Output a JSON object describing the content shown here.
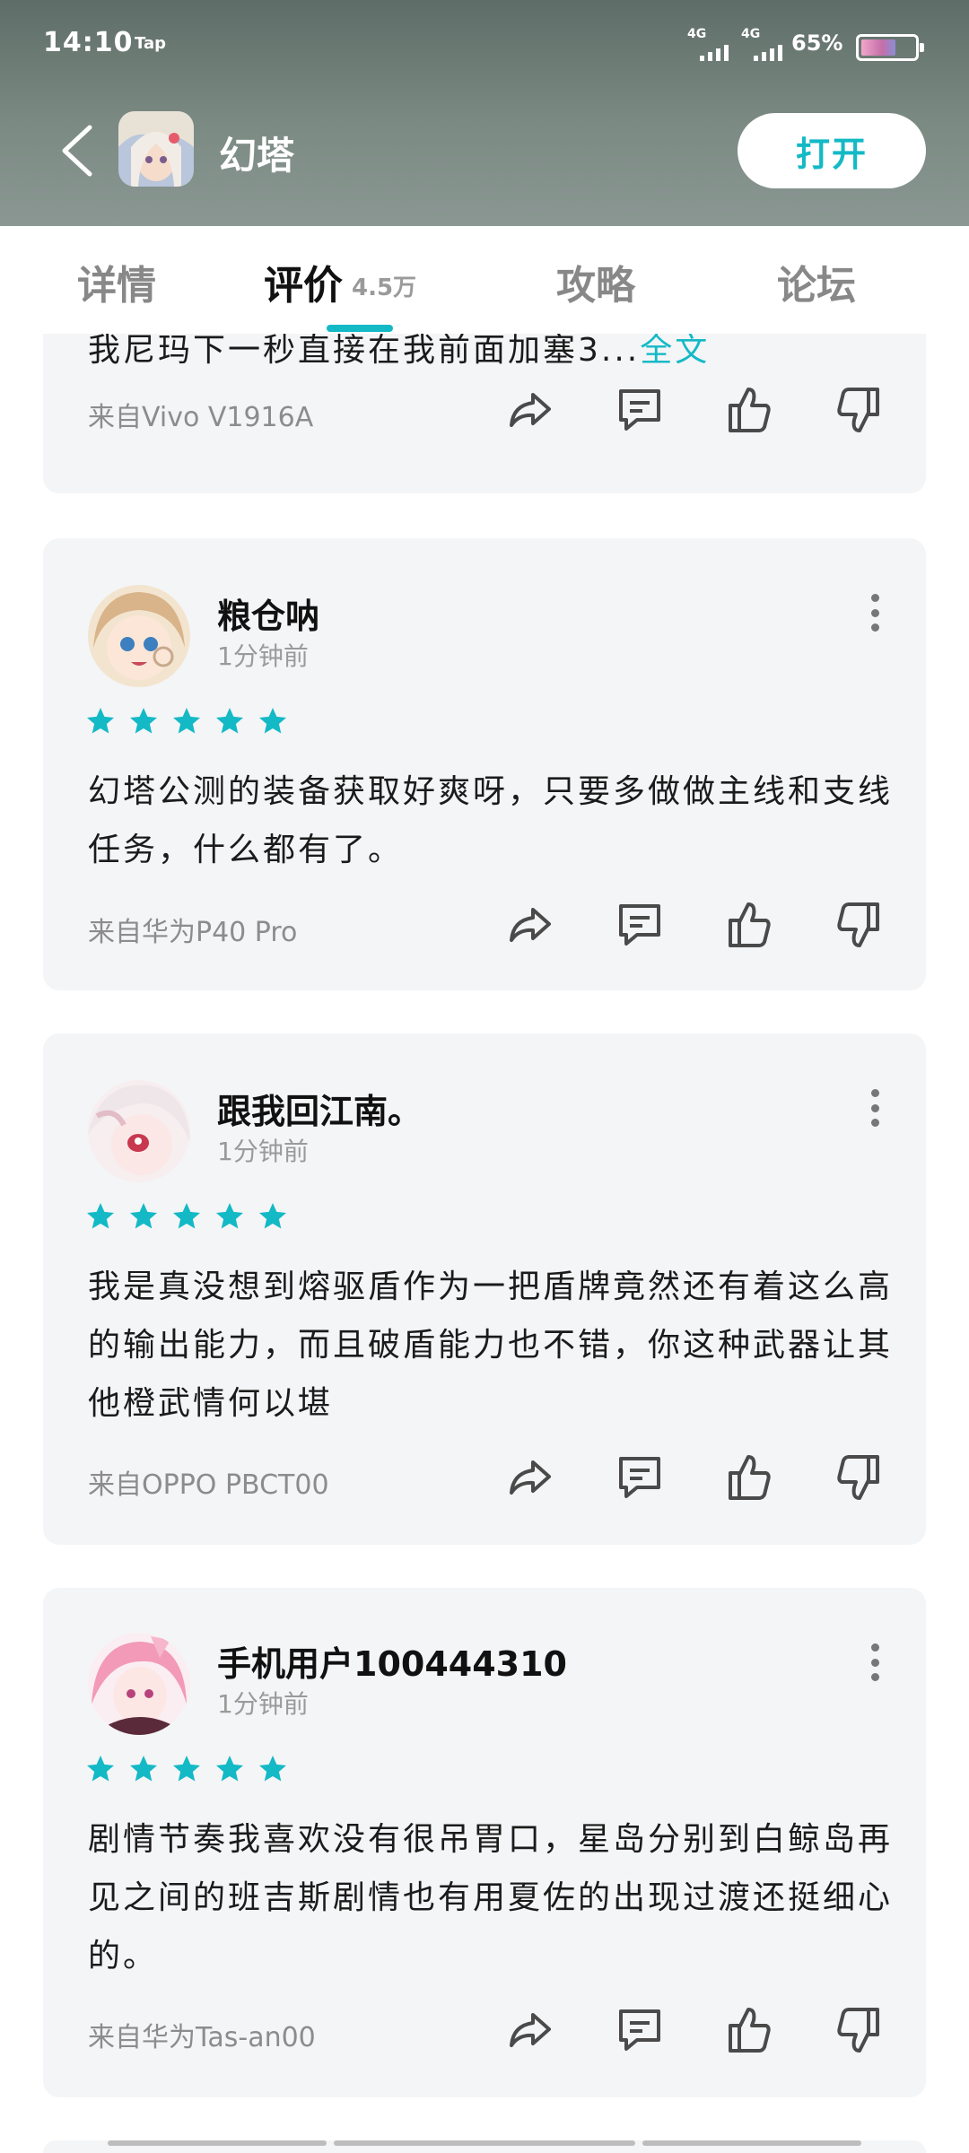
{
  "status_bar": {
    "time": "14:10",
    "carrier_logo": "Tap",
    "net1": "4G",
    "net2": "4G",
    "battery": "65%",
    "battery_level": 0.65
  },
  "app_bar": {
    "title": "幻塔",
    "open_label": "打开"
  },
  "tabs": [
    {
      "label": "详情"
    },
    {
      "label": "评价",
      "count": "4.5万"
    },
    {
      "label": "攻略"
    },
    {
      "label": "论坛"
    }
  ],
  "colors": {
    "accent": "#14b9c6",
    "card_bg": "#f4f5f7",
    "header": "#6e7c77"
  },
  "partial_review": {
    "content": "我尼玛下一秒直接在我前面加塞3...",
    "fulltext_label": "全文",
    "source": "来自Vivo V1916A"
  },
  "reviews": [
    {
      "username": "粮仓呐",
      "time": "1分钟前",
      "rating": 5,
      "content": "幻塔公测的装备获取好爽呀，只要多做做主线和支线任务，什么都有了。",
      "source": "来自华为P40 Pro"
    },
    {
      "username": "跟我回江南。",
      "time": "1分钟前",
      "rating": 5,
      "content": "我是真没想到熔驱盾作为一把盾牌竟然还有着这么高的输出能力，而且破盾能力也不错，你这种武器让其他橙武情何以堪",
      "source": "来自OPPO PBCT00"
    },
    {
      "username": "手机用户100444310",
      "time": "1分钟前",
      "rating": 5,
      "content": "剧情节奏我喜欢没有很吊胃口，星岛分别到白鲸岛再见之间的班吉斯剧情也有用夏佐的出现过渡还挺细心的。",
      "source": "来自华为Tas-an00"
    }
  ],
  "icons": [
    "back-icon",
    "share-icon",
    "comment-icon",
    "thumbs-up-icon",
    "thumbs-down-icon",
    "more-icon",
    "star-icon"
  ]
}
